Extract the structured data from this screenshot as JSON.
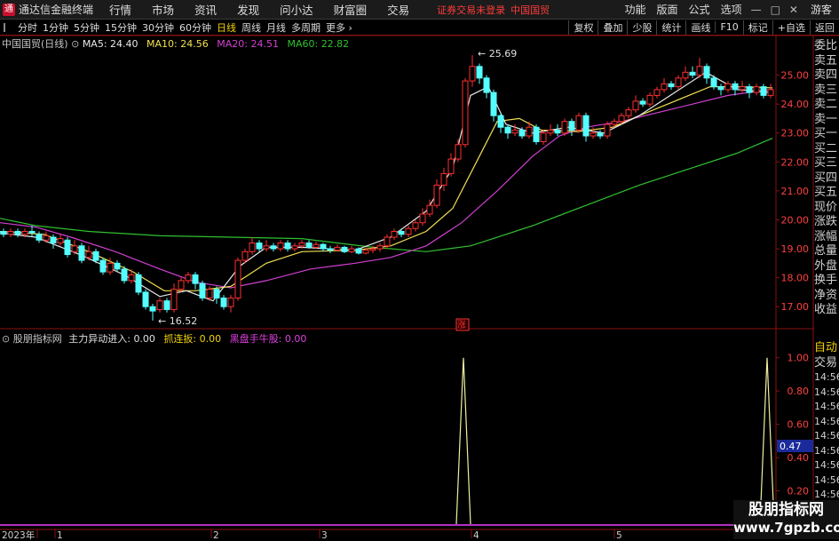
{
  "titlebar": {
    "app_name": "通达信金融终端",
    "menus": [
      "行情",
      "市场",
      "资讯",
      "发现",
      "问小达",
      "财富圈",
      "交易"
    ],
    "login_warning": "证券交易未登录",
    "stock_name": "中国国贸",
    "right_menus": [
      "功能",
      "版面",
      "公式",
      "选项"
    ],
    "user": "游客"
  },
  "toolbar": {
    "periods": [
      "分时",
      "1分钟",
      "5分钟",
      "15分钟",
      "30分钟",
      "60分钟",
      "日线",
      "周线",
      "月线",
      "多周期",
      "更多"
    ],
    "active_period": "日线",
    "right_buttons": [
      "复权",
      "叠加",
      "少股",
      "统计",
      "画线",
      "F10",
      "标记",
      "+自选",
      "返回"
    ]
  },
  "main_chart": {
    "label": "中国国贸(日线)",
    "ma": [
      {
        "name": "MA5",
        "value": "24.40",
        "color": "#e8e8e8"
      },
      {
        "name": "MA10",
        "value": "24.56",
        "color": "#f0e050"
      },
      {
        "name": "MA20",
        "value": "24.51",
        "color": "#d040d0"
      },
      {
        "name": "MA60",
        "value": "22.82",
        "color": "#30c030"
      }
    ],
    "high_label": "25.69",
    "low_label": "16.52",
    "marker": "涨",
    "y_ticks": [
      "25.00",
      "24.00",
      "23.00",
      "22.00",
      "21.00",
      "20.00",
      "19.00",
      "18.00",
      "17.00"
    ]
  },
  "sub_chart": {
    "name": "股朋指标网",
    "items": [
      {
        "label": "主力异动进入:",
        "value": "0.00",
        "color": "#e0e0e0"
      },
      {
        "label": "抓连扳:",
        "value": "0.00",
        "color": "#f2d20a"
      },
      {
        "label": "黑盘手牛股:",
        "value": "0.00",
        "color": "#e040e0"
      }
    ],
    "y_ticks": [
      "1.00",
      "0.80",
      "0.60",
      "0.40",
      "0.20"
    ],
    "current_value": "0.47"
  },
  "date_axis": [
    "2023年",
    "1",
    "2",
    "3",
    "4",
    "5"
  ],
  "sidebar_top": [
    "委比",
    "卖五",
    "卖四",
    "卖三",
    "卖二",
    "卖一",
    "买一",
    "买二",
    "买三",
    "买四",
    "买五",
    "现价",
    "涨跌",
    "涨幅",
    "总量",
    "外盘",
    "换手",
    "净资",
    "收益"
  ],
  "sidebar_bottom": [
    "自动",
    "交易",
    "14:56",
    "14:56",
    "14:56",
    "14:56",
    "14:56",
    "14:56",
    "14:56",
    "14:56",
    "14:56"
  ],
  "watermark": {
    "line1": "股朋指标网",
    "line2": "www.7gpzb.com"
  },
  "chart_data": {
    "type": "candlestick",
    "title": "中国国贸(日线)",
    "ylim": [
      16.3,
      26.0
    ],
    "y_ticks": [
      17,
      18,
      19,
      20,
      21,
      22,
      23,
      24,
      25
    ],
    "ma60": [
      [
        0,
        20.05
      ],
      [
        40,
        19.8
      ],
      [
        100,
        19.6
      ],
      [
        180,
        19.45
      ],
      [
        260,
        19.4
      ],
      [
        340,
        19.35
      ],
      [
        420,
        19.05
      ],
      [
        480,
        18.9
      ],
      [
        530,
        19.1
      ],
      [
        600,
        19.8
      ],
      [
        660,
        20.5
      ],
      [
        720,
        21.2
      ],
      [
        780,
        21.8
      ],
      [
        830,
        22.3
      ],
      [
        870,
        22.82
      ]
    ],
    "ma20": [
      [
        0,
        19.9
      ],
      [
        40,
        19.75
      ],
      [
        80,
        19.4
      ],
      [
        130,
        18.9
      ],
      [
        180,
        18.3
      ],
      [
        220,
        17.85
      ],
      [
        260,
        17.65
      ],
      [
        300,
        17.9
      ],
      [
        350,
        18.3
      ],
      [
        400,
        18.5
      ],
      [
        440,
        18.7
      ],
      [
        480,
        19.1
      ],
      [
        520,
        19.9
      ],
      [
        560,
        21.0
      ],
      [
        600,
        22.2
      ],
      [
        630,
        22.9
      ],
      [
        660,
        23.2
      ],
      [
        700,
        23.4
      ],
      [
        740,
        23.7
      ],
      [
        780,
        24.0
      ],
      [
        820,
        24.3
      ],
      [
        870,
        24.51
      ]
    ],
    "ma10": [
      [
        0,
        19.6
      ],
      [
        50,
        19.5
      ],
      [
        100,
        18.9
      ],
      [
        150,
        18.2
      ],
      [
        185,
        17.55
      ],
      [
        220,
        17.55
      ],
      [
        260,
        17.7
      ],
      [
        300,
        18.5
      ],
      [
        340,
        18.9
      ],
      [
        400,
        18.95
      ],
      [
        440,
        19.1
      ],
      [
        480,
        19.6
      ],
      [
        510,
        20.4
      ],
      [
        540,
        22.2
      ],
      [
        560,
        23.4
      ],
      [
        585,
        23.5
      ],
      [
        610,
        23.1
      ],
      [
        650,
        23.05
      ],
      [
        690,
        23.2
      ],
      [
        720,
        23.6
      ],
      [
        760,
        24.1
      ],
      [
        800,
        24.6
      ],
      [
        830,
        24.6
      ],
      [
        870,
        24.56
      ]
    ],
    "ma5": [
      [
        0,
        19.55
      ],
      [
        40,
        19.4
      ],
      [
        90,
        18.8
      ],
      [
        140,
        18.1
      ],
      [
        180,
        17.35
      ],
      [
        210,
        17.55
      ],
      [
        240,
        17.2
      ],
      [
        270,
        18.4
      ],
      [
        300,
        19.05
      ],
      [
        340,
        19.05
      ],
      [
        400,
        18.95
      ],
      [
        440,
        19.4
      ],
      [
        480,
        20.3
      ],
      [
        510,
        21.8
      ],
      [
        530,
        24.3
      ],
      [
        550,
        24.6
      ],
      [
        570,
        23.3
      ],
      [
        600,
        23.0
      ],
      [
        640,
        23.2
      ],
      [
        680,
        23.0
      ],
      [
        720,
        23.6
      ],
      [
        760,
        24.4
      ],
      [
        795,
        25.1
      ],
      [
        830,
        24.5
      ],
      [
        870,
        24.4
      ]
    ],
    "candles": [
      [
        4,
        19.6,
        19.5,
        19.7,
        19.4
      ],
      [
        12,
        19.5,
        19.6,
        19.7,
        19.4
      ],
      [
        20,
        19.6,
        19.5,
        19.7,
        19.4
      ],
      [
        28,
        19.5,
        19.6,
        19.7,
        19.4
      ],
      [
        36,
        19.6,
        19.55,
        19.8,
        19.4
      ],
      [
        44,
        19.5,
        19.3,
        19.6,
        19.2
      ],
      [
        52,
        19.3,
        19.45,
        19.6,
        19.2
      ],
      [
        60,
        19.4,
        19.2,
        19.5,
        19.0
      ],
      [
        68,
        19.2,
        19.35,
        19.5,
        19.1
      ],
      [
        76,
        19.3,
        18.8,
        19.4,
        18.7
      ],
      [
        84,
        18.9,
        19.1,
        19.3,
        18.8
      ],
      [
        92,
        19.1,
        18.6,
        19.2,
        18.5
      ],
      [
        100,
        18.7,
        18.9,
        19.1,
        18.6
      ],
      [
        108,
        18.9,
        18.6,
        19.0,
        18.5
      ],
      [
        116,
        18.6,
        18.2,
        18.7,
        18.1
      ],
      [
        124,
        18.2,
        18.5,
        18.7,
        18.1
      ],
      [
        132,
        18.5,
        18.3,
        18.6,
        18.2
      ],
      [
        140,
        18.3,
        17.9,
        18.4,
        17.8
      ],
      [
        148,
        17.9,
        18.1,
        18.3,
        17.8
      ],
      [
        156,
        18.1,
        17.5,
        18.2,
        17.4
      ],
      [
        164,
        17.5,
        17.0,
        17.6,
        16.9
      ],
      [
        172,
        17.0,
        16.85,
        17.1,
        16.52
      ],
      [
        180,
        16.9,
        17.2,
        17.3,
        16.8
      ],
      [
        188,
        17.2,
        16.9,
        17.3,
        16.8
      ],
      [
        196,
        16.9,
        17.6,
        17.8,
        16.8
      ],
      [
        204,
        17.6,
        17.9,
        18.0,
        17.5
      ],
      [
        212,
        17.9,
        18.1,
        18.2,
        17.8
      ],
      [
        220,
        18.1,
        17.8,
        18.2,
        17.6
      ],
      [
        228,
        17.8,
        17.3,
        17.9,
        17.2
      ],
      [
        236,
        17.3,
        17.6,
        17.7,
        17.2
      ],
      [
        244,
        17.6,
        17.3,
        17.7,
        17.1
      ],
      [
        252,
        17.3,
        17.0,
        17.4,
        16.9
      ],
      [
        260,
        17.0,
        17.3,
        17.4,
        16.8
      ],
      [
        268,
        17.3,
        18.6,
        18.7,
        17.2
      ],
      [
        276,
        18.6,
        18.9,
        19.0,
        18.5
      ],
      [
        284,
        18.9,
        19.2,
        19.4,
        18.8
      ],
      [
        292,
        19.2,
        19.0,
        19.3,
        18.9
      ],
      [
        300,
        19.0,
        19.1,
        19.3,
        18.9
      ],
      [
        308,
        19.1,
        19.0,
        19.2,
        18.9
      ],
      [
        316,
        19.0,
        19.2,
        19.3,
        18.9
      ],
      [
        324,
        19.2,
        19.0,
        19.3,
        18.9
      ],
      [
        332,
        19.0,
        19.1,
        19.2,
        18.9
      ],
      [
        340,
        19.1,
        19.2,
        19.3,
        19.0
      ],
      [
        348,
        19.2,
        19.05,
        19.3,
        19.0
      ],
      [
        356,
        19.05,
        19.15,
        19.25,
        19.0
      ],
      [
        364,
        19.15,
        19.0,
        19.2,
        18.9
      ],
      [
        372,
        19.0,
        18.95,
        19.1,
        18.85
      ],
      [
        380,
        18.95,
        19.05,
        19.15,
        18.9
      ],
      [
        388,
        19.05,
        18.9,
        19.1,
        18.85
      ],
      [
        396,
        18.9,
        19.0,
        19.1,
        18.85
      ],
      [
        404,
        19.0,
        18.85,
        19.05,
        18.8
      ],
      [
        412,
        18.85,
        18.95,
        19.05,
        18.8
      ],
      [
        420,
        18.95,
        19.0,
        19.1,
        18.85
      ],
      [
        428,
        19.0,
        19.1,
        19.2,
        18.9
      ],
      [
        436,
        19.1,
        19.4,
        19.5,
        19.0
      ],
      [
        444,
        19.4,
        19.6,
        19.7,
        19.3
      ],
      [
        452,
        19.6,
        19.5,
        19.7,
        19.4
      ],
      [
        460,
        19.5,
        19.7,
        19.8,
        19.4
      ],
      [
        468,
        19.7,
        19.9,
        20.0,
        19.6
      ],
      [
        476,
        19.9,
        20.2,
        20.4,
        19.8
      ],
      [
        484,
        20.2,
        20.5,
        20.7,
        20.1
      ],
      [
        492,
        20.5,
        21.2,
        21.4,
        20.4
      ],
      [
        500,
        21.2,
        21.6,
        21.8,
        21.0
      ],
      [
        508,
        21.6,
        22.1,
        22.3,
        21.5
      ],
      [
        516,
        22.1,
        22.6,
        22.8,
        22.0
      ],
      [
        524,
        22.6,
        24.8,
        24.9,
        22.5
      ],
      [
        532,
        24.8,
        25.3,
        25.69,
        24.6
      ],
      [
        540,
        25.3,
        24.9,
        25.4,
        24.7
      ],
      [
        548,
        24.9,
        24.4,
        25.0,
        24.2
      ],
      [
        556,
        24.4,
        23.6,
        24.5,
        23.4
      ],
      [
        564,
        23.6,
        23.2,
        23.7,
        23.0
      ],
      [
        572,
        23.2,
        23.0,
        23.3,
        22.8
      ],
      [
        580,
        23.0,
        23.1,
        23.3,
        22.9
      ],
      [
        588,
        23.1,
        22.9,
        23.2,
        22.8
      ],
      [
        596,
        22.9,
        23.2,
        23.4,
        22.8
      ],
      [
        604,
        23.2,
        22.7,
        23.3,
        22.6
      ],
      [
        612,
        22.7,
        23.0,
        23.1,
        22.6
      ],
      [
        620,
        23.0,
        23.1,
        23.3,
        22.9
      ],
      [
        628,
        23.1,
        23.0,
        23.3,
        22.9
      ],
      [
        636,
        23.0,
        23.4,
        23.5,
        22.9
      ],
      [
        644,
        23.4,
        23.1,
        23.5,
        22.9
      ],
      [
        652,
        23.1,
        23.6,
        23.7,
        23.0
      ],
      [
        660,
        23.6,
        22.9,
        23.7,
        22.7
      ],
      [
        668,
        22.9,
        23.0,
        23.2,
        22.8
      ],
      [
        676,
        23.0,
        22.9,
        23.1,
        22.8
      ],
      [
        684,
        22.9,
        23.3,
        23.4,
        22.8
      ],
      [
        692,
        23.3,
        23.4,
        23.5,
        23.2
      ],
      [
        700,
        23.4,
        23.6,
        23.7,
        23.3
      ],
      [
        708,
        23.6,
        23.8,
        23.9,
        23.5
      ],
      [
        716,
        23.8,
        24.1,
        24.3,
        23.7
      ],
      [
        724,
        24.1,
        24.0,
        24.2,
        23.9
      ],
      [
        732,
        24.0,
        24.3,
        24.4,
        23.9
      ],
      [
        740,
        24.3,
        24.5,
        24.6,
        24.2
      ],
      [
        748,
        24.5,
        24.7,
        24.9,
        24.4
      ],
      [
        756,
        24.7,
        24.6,
        24.8,
        24.5
      ],
      [
        764,
        24.6,
        24.9,
        25.0,
        24.5
      ],
      [
        772,
        24.9,
        25.1,
        25.3,
        24.8
      ],
      [
        780,
        25.1,
        25.0,
        25.3,
        24.9
      ],
      [
        788,
        25.0,
        25.3,
        25.6,
        24.9
      ],
      [
        796,
        25.3,
        24.9,
        25.4,
        24.7
      ],
      [
        804,
        24.9,
        24.6,
        25.0,
        24.5
      ],
      [
        812,
        24.6,
        24.5,
        24.7,
        24.3
      ],
      [
        820,
        24.5,
        24.7,
        24.8,
        24.4
      ],
      [
        828,
        24.7,
        24.5,
        24.8,
        24.3
      ],
      [
        836,
        24.5,
        24.6,
        24.8,
        24.4
      ],
      [
        844,
        24.6,
        24.4,
        24.7,
        24.2
      ],
      [
        852,
        24.4,
        24.6,
        24.7,
        24.3
      ],
      [
        860,
        24.6,
        24.3,
        24.7,
        24.2
      ],
      [
        868,
        24.3,
        24.5,
        24.7,
        24.2
      ]
    ],
    "sub_series": {
      "ylim": [
        0,
        1.1
      ],
      "spikes": [
        {
          "x": 522,
          "value": 1.0
        },
        {
          "x": 864,
          "value": 1.0
        }
      ]
    }
  }
}
